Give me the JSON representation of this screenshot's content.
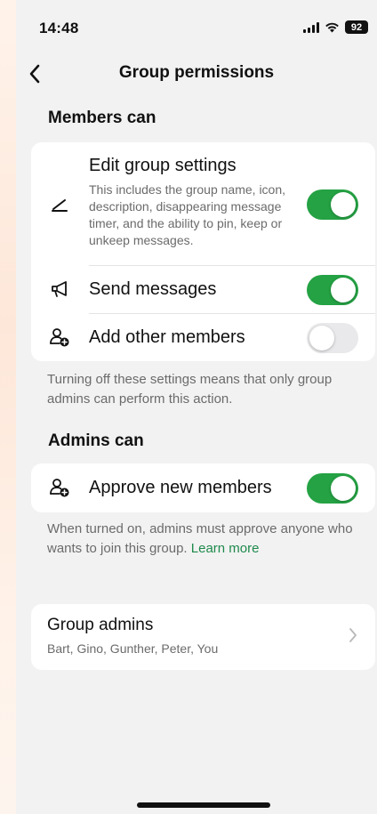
{
  "status_bar": {
    "time": "14:48",
    "battery": "92",
    "icons": [
      "signal-icon",
      "wifi-icon",
      "battery-icon"
    ]
  },
  "header": {
    "title": "Group permissions",
    "back_icon": "chevron-left-icon"
  },
  "members_section": {
    "heading": "Members can",
    "items": [
      {
        "title": "Edit group settings",
        "description": "This includes the group name, icon, description, disappearing message timer, and the ability to pin, keep or unkeep messages.",
        "icon": "pencil-icon",
        "enabled": true
      },
      {
        "title": "Send messages",
        "icon": "megaphone-icon",
        "enabled": true
      },
      {
        "title": "Add other members",
        "icon": "add-person-icon",
        "enabled": false
      }
    ],
    "footnote": "Turning off these settings means that only group admins can perform this action."
  },
  "admins_section": {
    "heading": "Admins can",
    "items": [
      {
        "title": "Approve new members",
        "icon": "add-person-icon",
        "enabled": true
      }
    ],
    "footnote": "When turned on, admins must approve anyone who wants to join this group.",
    "learn_more": "Learn more"
  },
  "group_admins": {
    "title": "Group admins",
    "names": "Bart, Gino, Gunther, Peter, You",
    "chevron_icon": "chevron-right-icon"
  },
  "colors": {
    "toggle_on": "#25a244",
    "toggle_off": "#e9e9eb",
    "link": "#1f8a4c",
    "background": "#f2f2f2"
  }
}
